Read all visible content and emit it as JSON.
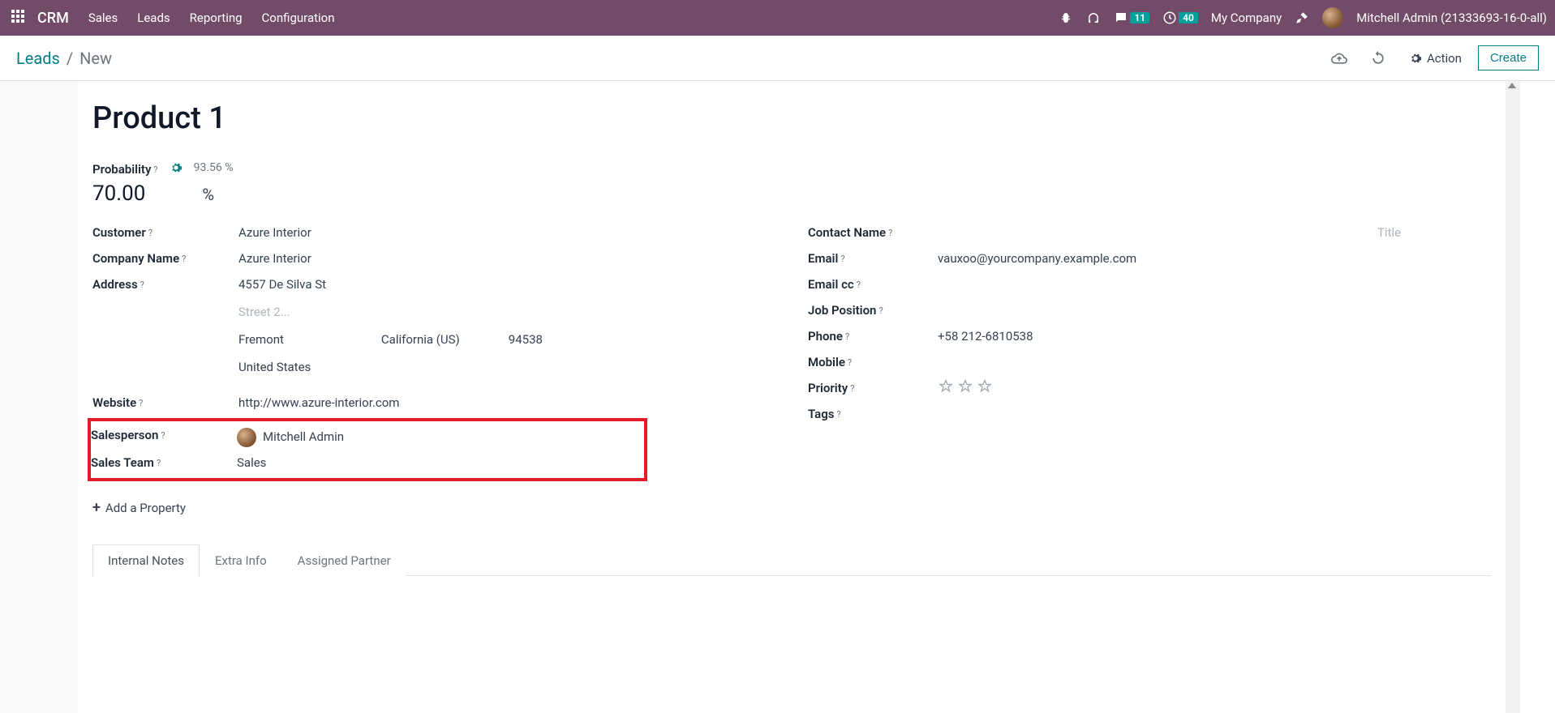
{
  "nav": {
    "brand": "CRM",
    "items": [
      "Sales",
      "Leads",
      "Reporting",
      "Configuration"
    ],
    "chat_badge": "11",
    "clock_badge": "40",
    "company": "My Company",
    "user": "Mitchell Admin (21333693-16-0-all)"
  },
  "breadcrumb": {
    "root": "Leads",
    "current": "New"
  },
  "controls": {
    "action": "Action",
    "create": "Create"
  },
  "lead": {
    "title": "Product 1",
    "probability_label": "Probability",
    "auto_prob": "93.56 %",
    "probability_value": "70.00",
    "percent": "%",
    "customer_label": "Customer",
    "customer": "Azure Interior",
    "company_name_label": "Company Name",
    "company_name": "Azure Interior",
    "address_label": "Address",
    "street1": "4557 De Silva St",
    "street2_placeholder": "Street 2...",
    "city": "Fremont",
    "state": "California (US)",
    "zip": "94538",
    "country": "United States",
    "website_label": "Website",
    "website": "http://www.azure-interior.com",
    "salesperson_label": "Salesperson",
    "salesperson": "Mitchell Admin",
    "sales_team_label": "Sales Team",
    "sales_team": "Sales",
    "contact_name_label": "Contact Name",
    "contact_title_placeholder": "Title",
    "email_label": "Email",
    "email": "vauxoo@yourcompany.example.com",
    "email_cc_label": "Email cc",
    "job_position_label": "Job Position",
    "phone_label": "Phone",
    "phone": "+58 212-6810538",
    "mobile_label": "Mobile",
    "priority_label": "Priority",
    "tags_label": "Tags",
    "add_property": "Add a Property"
  },
  "tabs": [
    "Internal Notes",
    "Extra Info",
    "Assigned Partner"
  ]
}
